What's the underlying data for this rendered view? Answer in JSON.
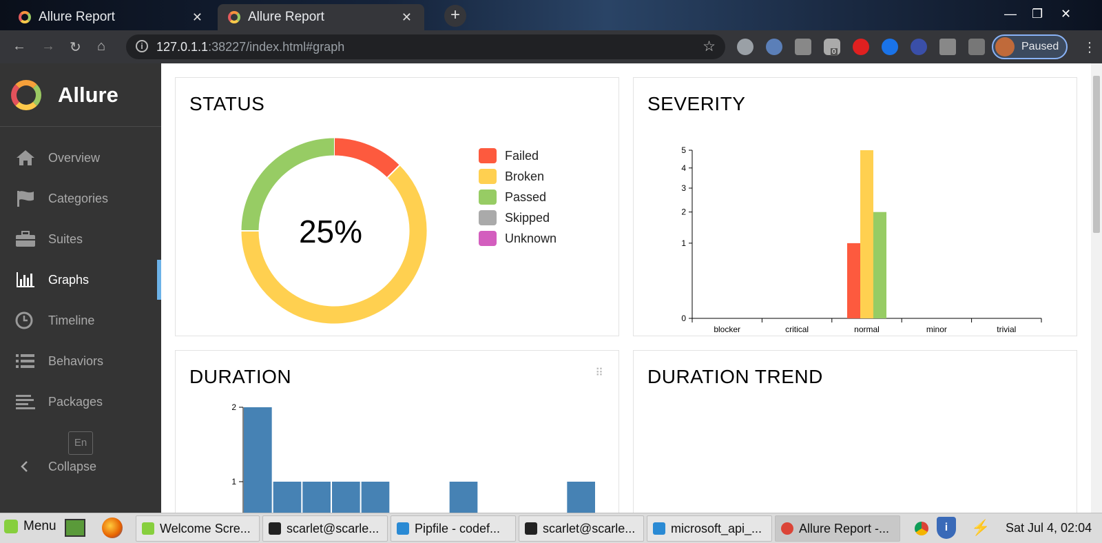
{
  "browser": {
    "tabs": [
      {
        "title": "Allure Report"
      },
      {
        "title": "Allure Report"
      }
    ],
    "new_tab": "+",
    "close_glyph": "✕",
    "url_host": "127.0.1.1",
    "url_path": ":38227/index.html#graph",
    "profile_label": "Paused",
    "extension_badge": "0"
  },
  "sidebar": {
    "brand": "Allure",
    "items": [
      {
        "label": "Overview",
        "icon": "home-icon"
      },
      {
        "label": "Categories",
        "icon": "flag-icon"
      },
      {
        "label": "Suites",
        "icon": "briefcase-icon"
      },
      {
        "label": "Graphs",
        "icon": "bar-chart-icon"
      },
      {
        "label": "Timeline",
        "icon": "clock-icon"
      },
      {
        "label": "Behaviors",
        "icon": "list-icon"
      },
      {
        "label": "Packages",
        "icon": "align-left-icon"
      }
    ],
    "language": "En",
    "collapse": "Collapse"
  },
  "panels": {
    "status": {
      "title": "STATUS"
    },
    "severity": {
      "title": "SEVERITY"
    },
    "duration": {
      "title": "DURATION"
    },
    "duration_trend": {
      "title": "DURATION TREND"
    }
  },
  "colors": {
    "failed": "#fd5a3e",
    "broken": "#ffd050",
    "passed": "#97cc64",
    "skipped": "#aaaaaa",
    "unknown": "#d35ebe",
    "duration_bar": "#4682b4",
    "accent": "#6cb2e8"
  },
  "chart_data": [
    {
      "type": "pie",
      "variant": "donut",
      "center_label": "25%",
      "categories": [
        "Failed",
        "Broken",
        "Passed",
        "Skipped",
        "Unknown"
      ],
      "values": [
        1,
        5,
        2,
        0,
        0
      ]
    },
    {
      "type": "bar",
      "categories": [
        "blocker",
        "critical",
        "normal",
        "minor",
        "trivial"
      ],
      "series": [
        {
          "name": "Failed",
          "values": [
            0,
            0,
            1,
            0,
            0
          ]
        },
        {
          "name": "Broken",
          "values": [
            0,
            0,
            5,
            0,
            0
          ]
        },
        {
          "name": "Passed",
          "values": [
            0,
            0,
            2,
            0,
            0
          ]
        }
      ],
      "yticks": [
        "0",
        "1",
        "2",
        "3",
        "4",
        "5"
      ],
      "ylim": [
        0,
        5
      ],
      "yscale": "sqrt"
    },
    {
      "type": "bar",
      "bins": 12,
      "values": [
        2,
        1,
        1,
        1,
        1,
        0,
        0,
        1,
        0,
        0,
        0,
        1
      ],
      "yticks": [
        "1",
        "2"
      ],
      "ylim": [
        0,
        2
      ]
    }
  ],
  "taskbar": {
    "menu": "Menu",
    "items": [
      {
        "label": "Welcome Scre..."
      },
      {
        "label": "scarlet@scarle..."
      },
      {
        "label": "Pipfile - codef..."
      },
      {
        "label": "scarlet@scarle..."
      },
      {
        "label": "microsoft_api_..."
      },
      {
        "label": "Allure Report -..."
      }
    ],
    "clock": "Sat Jul  4, 02:04"
  }
}
